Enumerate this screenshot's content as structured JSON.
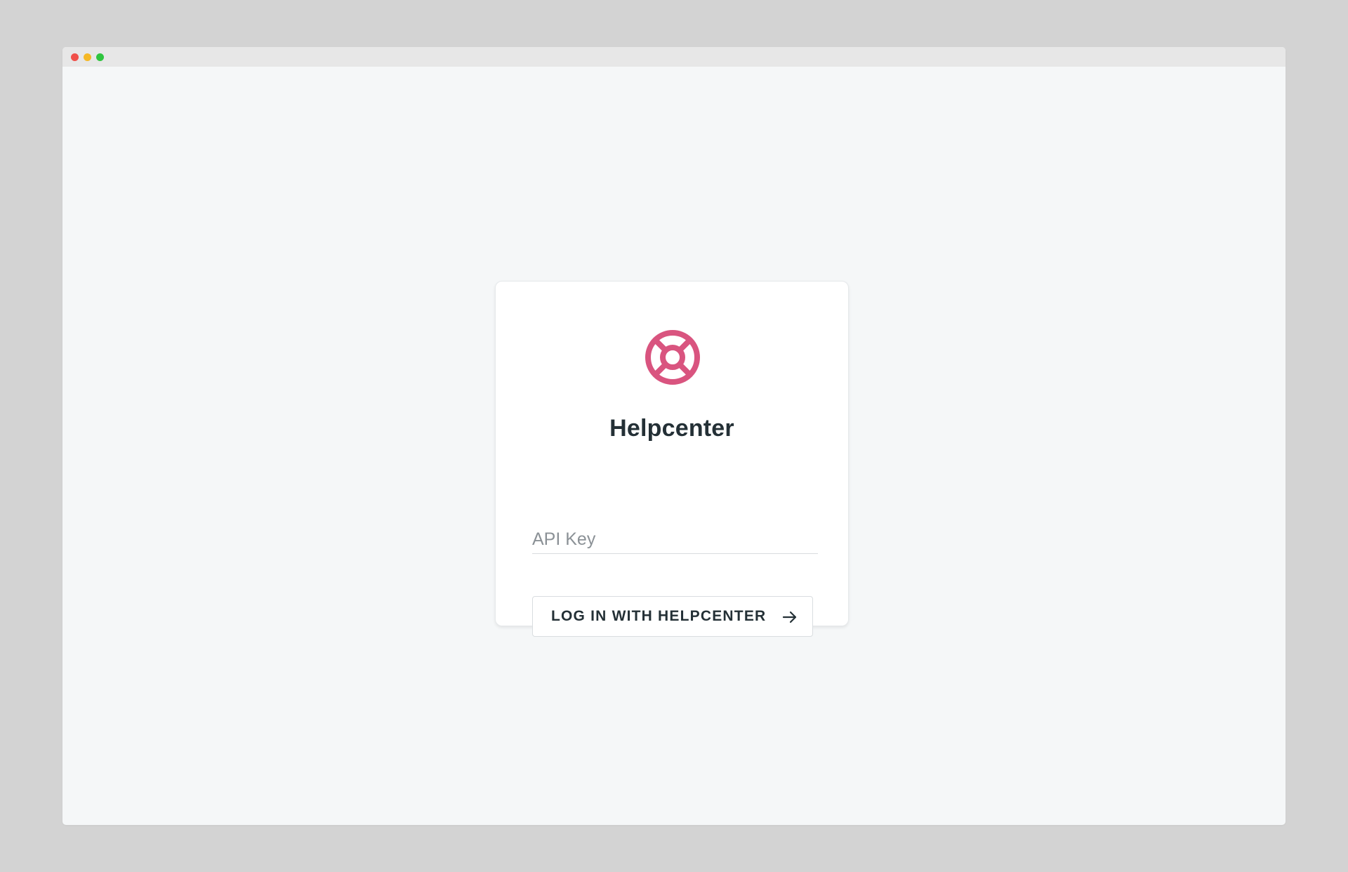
{
  "window": {
    "controls": [
      "close",
      "minimize",
      "maximize"
    ],
    "colors": {
      "close": "#f0504a",
      "minimize": "#f5b826",
      "maximize": "#2fc53f"
    }
  },
  "login": {
    "logo_icon": "lifebuoy-icon",
    "brand_color": "#d9547f",
    "title": "Helpcenter",
    "api_key": {
      "value": "",
      "placeholder": "API Key"
    },
    "button_label": "LOG IN WITH HELPCENTER",
    "button_icon": "arrow-right-icon"
  }
}
